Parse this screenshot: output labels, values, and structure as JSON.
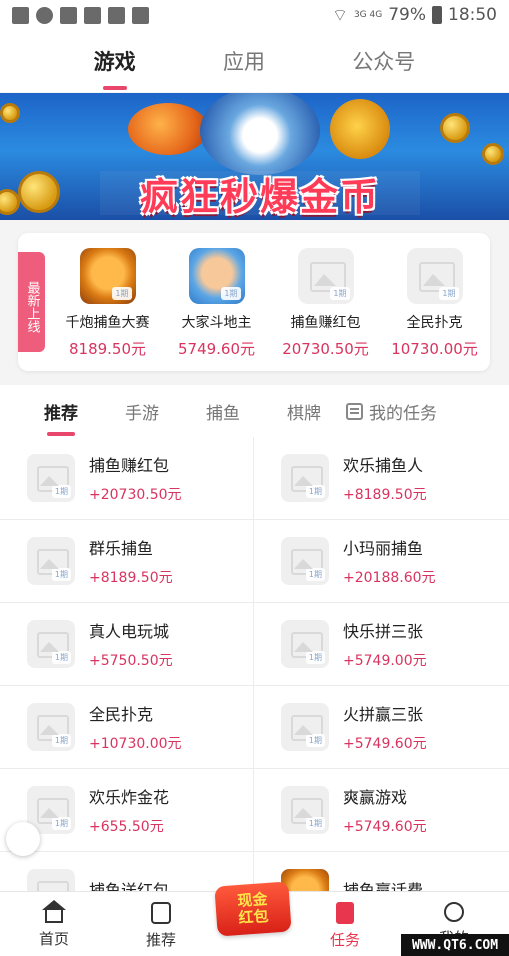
{
  "status_bar": {
    "network": "3G 4G",
    "battery": "79%",
    "time": "18:50"
  },
  "top_tabs": [
    {
      "label": "游戏",
      "active": true
    },
    {
      "label": "应用",
      "active": false
    },
    {
      "label": "公众号",
      "active": false
    }
  ],
  "banner": {
    "title": "疯狂秒爆金币"
  },
  "new_games": {
    "badge": "最新上线",
    "items": [
      {
        "name": "千炮捕鱼大赛",
        "price": "8189.50元",
        "period": "1期",
        "icon": "fish-game-icon"
      },
      {
        "name": "大家斗地主",
        "price": "5749.60元",
        "period": "1期",
        "icon": "doudizhu-icon"
      },
      {
        "name": "捕鱼赚红包",
        "price": "20730.50元",
        "period": "1期",
        "icon": "placeholder-image-icon"
      },
      {
        "name": "全民扑克",
        "price": "10730.00元",
        "period": "1期",
        "icon": "placeholder-image-icon"
      }
    ]
  },
  "category_tabs": [
    {
      "label": "推荐",
      "active": true
    },
    {
      "label": "手游",
      "active": false
    },
    {
      "label": "捕鱼",
      "active": false
    },
    {
      "label": "棋牌",
      "active": false
    }
  ],
  "my_tasks_label": "我的任务",
  "game_list": [
    {
      "name": "捕鱼赚红包",
      "reward": "+20730.50元",
      "period": "1期"
    },
    {
      "name": "欢乐捕鱼人",
      "reward": "+8189.50元",
      "period": "1期"
    },
    {
      "name": "群乐捕鱼",
      "reward": "+8189.50元",
      "period": "1期"
    },
    {
      "name": "小玛丽捕鱼",
      "reward": "+20188.60元",
      "period": "1期"
    },
    {
      "name": "真人电玩城",
      "reward": "+5750.50元",
      "period": "1期"
    },
    {
      "name": "快乐拼三张",
      "reward": "+5749.00元",
      "period": "1期"
    },
    {
      "name": "全民扑克",
      "reward": "+10730.00元",
      "period": "1期"
    },
    {
      "name": "火拼赢三张",
      "reward": "+5749.60元",
      "period": "1期"
    },
    {
      "name": "欢乐炸金花",
      "reward": "+655.50元",
      "period": "1期"
    },
    {
      "name": "爽赢游戏",
      "reward": "+5749.60元",
      "period": "1期"
    },
    {
      "name": "捕鱼送红包",
      "reward": "",
      "period": "1期"
    },
    {
      "name": "捕鱼赢话费",
      "reward": "",
      "period": ""
    }
  ],
  "bottom_nav": [
    {
      "label": "首页",
      "icon": "home-icon",
      "active": false
    },
    {
      "label": "推荐",
      "icon": "recommend-icon",
      "active": false
    },
    {
      "label": "任务",
      "icon": "task-icon",
      "active": true
    },
    {
      "label": "我的",
      "icon": "profile-icon",
      "active": false
    }
  ],
  "red_packet": {
    "line1": "现金",
    "line2": "红包"
  },
  "watermark": "WWW.QT6.COM",
  "colors": {
    "accent": "#e8466b",
    "price": "#d8345f",
    "badge": "#ee5d7b"
  }
}
